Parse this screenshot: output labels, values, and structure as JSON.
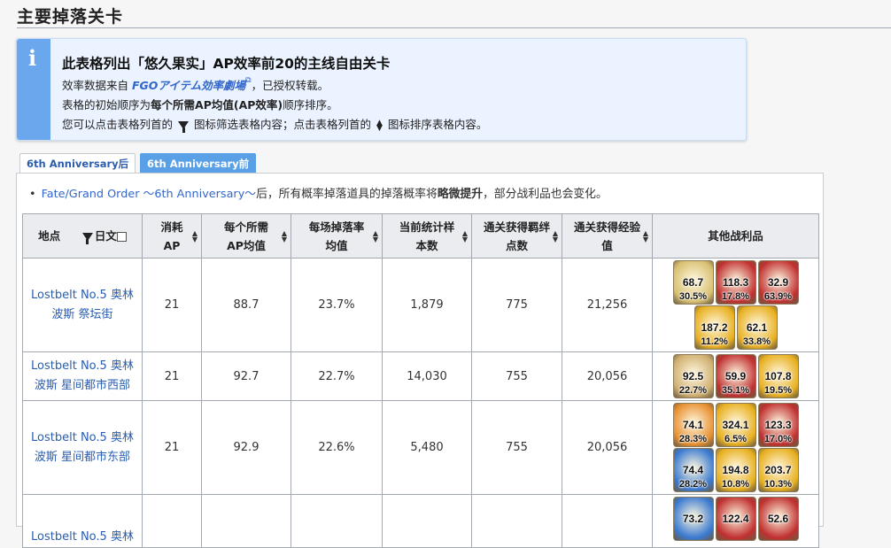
{
  "page": {
    "title": "主要掉落关卡"
  },
  "info": {
    "icon": "info-icon",
    "heading": "此表格列出「悠久果实」AP效率前20的主线自由关卡",
    "line1_prefix": "效率数据来自 ",
    "line1_link": "FGOアイテム効率劇場",
    "line1_suffix": "，已授权转载。",
    "line2_prefix": "表格的初始顺序为",
    "line2_bold": "每个所需AP均值(AP效率)",
    "line2_suffix": "顺序排序。",
    "line3_a": "您可以点击表格列首的",
    "line3_b": "图标筛选表格内容；点击表格列首的",
    "line3_c": "图标排序表格内容。"
  },
  "tabs": [
    {
      "label": "6th Anniversary后",
      "active": true
    },
    {
      "label": "6th Anniversary前",
      "active": false
    }
  ],
  "note": {
    "link": "Fate/Grand Order ～6th Anniversary～",
    "text_a": "后，所有概率掉落道具的掉落概率将",
    "bold": "略微提升",
    "text_b": "，部分战利品也会变化。"
  },
  "table": {
    "headers": {
      "location": "地点",
      "jp_toggle": "日文",
      "ap": "消耗AP",
      "ap_avg": "每个所需AP均值",
      "drop_rate": "每场掉落率均值",
      "sample": "当前统计样本数",
      "bond": "通关获得羁绊点数",
      "exp": "通关获得经验值",
      "other": "其他战利品"
    },
    "rows": [
      {
        "location": "Lostbelt No.5 奥林波斯 祭坛街",
        "ap": "21",
        "ap_avg": "88.7",
        "drop_rate": "23.7%",
        "sample": "1,879",
        "bond": "775",
        "exp": "21,256",
        "items": [
          {
            "icon": "seed-icon",
            "color": "#d8c070",
            "v1": "68.7",
            "v2": "30.5%"
          },
          {
            "icon": "red-gem-icon",
            "color": "#c03030",
            "v1": "118.3",
            "v2": "17.8%"
          },
          {
            "icon": "red-gem-icon",
            "color": "#c03030",
            "v1": "32.9",
            "v2": "63.9%"
          },
          {
            "icon": "gold-spark-icon",
            "color": "#e8b020",
            "v1": "187.2",
            "v2": "11.2%"
          },
          {
            "icon": "gold-spark-icon",
            "color": "#e8b020",
            "v1": "62.1",
            "v2": "33.8%"
          }
        ]
      },
      {
        "location": "Lostbelt No.5 奥林波斯 星间都市西部",
        "ap": "21",
        "ap_avg": "92.7",
        "drop_rate": "22.7%",
        "sample": "14,030",
        "bond": "755",
        "exp": "20,056",
        "items": [
          {
            "icon": "ring-icon",
            "color": "#d0b070",
            "v1": "92.5",
            "v2": "22.7%"
          },
          {
            "icon": "red-gem-icon",
            "color": "#c03030",
            "v1": "59.9",
            "v2": "35.1%"
          },
          {
            "icon": "gold-spark-icon",
            "color": "#e8b020",
            "v1": "107.8",
            "v2": "19.5%"
          }
        ]
      },
      {
        "location": "Lostbelt No.5 奥林波斯 星间都市东部",
        "ap": "21",
        "ap_avg": "92.9",
        "drop_rate": "22.6%",
        "sample": "5,480",
        "bond": "755",
        "exp": "20,056",
        "items": [
          {
            "icon": "orange-spark-icon",
            "color": "#e89030",
            "v1": "74.1",
            "v2": "28.3%"
          },
          {
            "icon": "gold-spark-icon",
            "color": "#e8b020",
            "v1": "324.1",
            "v2": "6.5%"
          },
          {
            "icon": "red-gem-icon",
            "color": "#c03030",
            "v1": "123.3",
            "v2": "17.0%"
          },
          {
            "icon": "blue-orb-icon",
            "color": "#3a7ad0",
            "v1": "74.4",
            "v2": "28.2%"
          },
          {
            "icon": "gold-spark-icon",
            "color": "#e8b020",
            "v1": "194.8",
            "v2": "10.8%"
          },
          {
            "icon": "gold-spark-icon",
            "color": "#e8b020",
            "v1": "203.7",
            "v2": "10.3%"
          }
        ]
      },
      {
        "location": "Lostbelt No.5 奥林",
        "ap": "",
        "ap_avg": "",
        "drop_rate": "",
        "sample": "",
        "bond": "",
        "exp": "",
        "items": [
          {
            "icon": "blue-orb-icon",
            "color": "#3a7ad0",
            "v1": "73.2",
            "v2": ""
          },
          {
            "icon": "red-gem-icon",
            "color": "#c03030",
            "v1": "122.4",
            "v2": ""
          },
          {
            "icon": "red-gem-icon",
            "color": "#c03030",
            "v1": "52.6",
            "v2": ""
          }
        ]
      }
    ]
  }
}
